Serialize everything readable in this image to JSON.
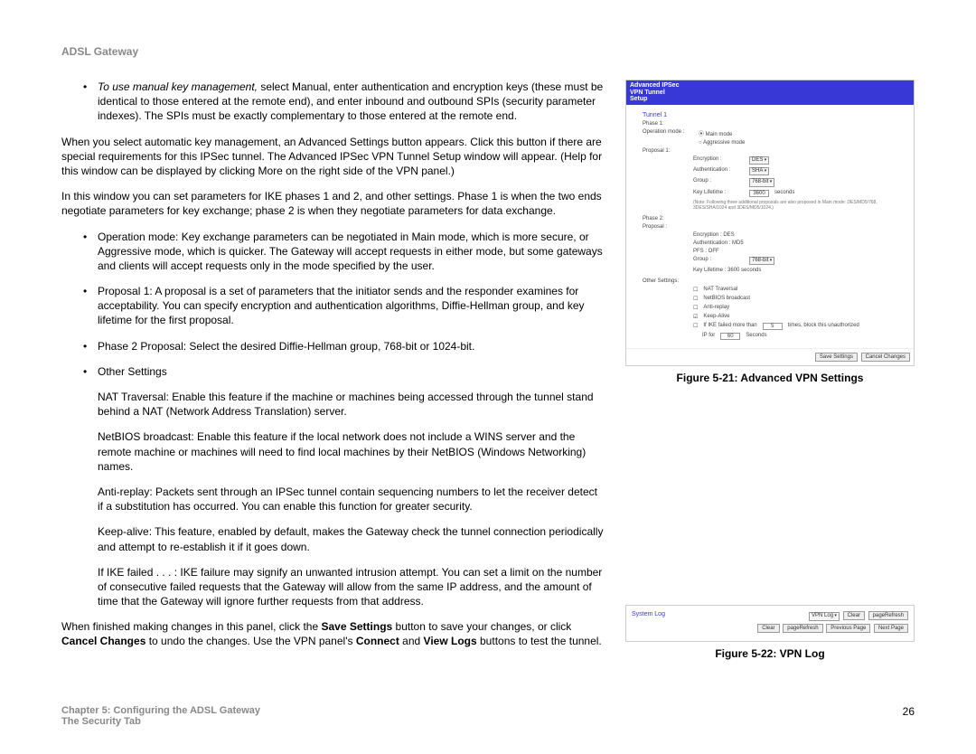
{
  "header": {
    "title": "ADSL Gateway"
  },
  "text": {
    "bullet_manual_pre": "To use manual key management,",
    "bullet_manual_post": " select Manual, enter authentication and encryption keys (these must be identical to those entered at the remote end), and enter inbound and outbound SPIs (security parameter indexes). The SPIs must be exactly complementary to those entered at the remote end.",
    "para_auto": "When you select automatic key management, an Advanced Settings button appears. Click this button if there are special requirements for this IPSec tunnel. The Advanced IPSec VPN Tunnel Setup window will appear. (Help for this window can be displayed by clicking More on the right side of the VPN panel.)",
    "para_phases": "In this window you can set parameters for IKE phases 1 and 2, and other settings. Phase 1 is when the two ends negotiate parameters for key exchange; phase 2 is when they negotiate parameters for data exchange.",
    "b_op": "Operation mode: Key exchange parameters can be negotiated in Main mode, which is more secure, or Aggressive mode, which is quicker. The Gateway will accept requests in either mode, but some gateways and clients will accept requests only in the mode specified by the user.",
    "b_prop1": "Proposal 1: A proposal is a set of parameters that the initiator sends and the responder examines for acceptability. You can specify encryption and authentication algorithms, Diffie-Hellman group, and key lifetime for the first proposal.",
    "b_phase2": "Phase 2 Proposal: Select the desired Diffie-Hellman group, 768-bit or 1024-bit.",
    "b_other": "Other Settings",
    "sub_nat": "NAT Traversal: Enable this feature if the machine or machines being accessed through the tunnel stand behind a NAT (Network Address Translation) server.",
    "sub_netbios": "NetBIOS broadcast: Enable this feature if the local network does not include a WINS server and the remote machine or machines will need to find local machines by their NetBIOS (Windows Networking) names.",
    "sub_anti": "Anti-replay: Packets sent through an IPSec tunnel contain sequencing numbers to let the receiver detect if a substitution has occurred. You can enable this function for greater security.",
    "sub_keep": "Keep-alive: This feature, enabled by default, makes the Gateway check the tunnel connection periodically and attempt to re-establish it if it goes down.",
    "sub_ike": "If IKE failed . . . : IKE failure may signify an unwanted intrusion attempt. You can set a limit on the number of consecutive failed requests that the Gateway will allow from the same IP address, and the amount of time that the Gateway will ignore further requests from that address.",
    "final_pre": "When finished making changes in this panel, click the ",
    "final_save": "Save Settings",
    "final_mid1": " button to save your changes, or click ",
    "final_cancel": "Cancel Changes",
    "final_mid2": " to undo the changes. Use the VPN panel's ",
    "final_connect": "Connect",
    "final_and": " and ",
    "final_view": "View Logs",
    "final_end": " buttons to test the tunnel."
  },
  "fig1": {
    "caption": "Figure 5-21: Advanced VPN Settings",
    "header": "Advanced IPSec\nVPN Tunnel\nSetup",
    "tunnel": "Tunnel 1",
    "phase1": "Phase 1:",
    "opmode": "Operation mode :",
    "main": "Main mode",
    "aggr": "Aggressive mode",
    "prop1": "Proposal 1:",
    "enc": "Encryption :",
    "enc_v": "DES",
    "auth": "Authentication :",
    "auth_v": "SHA",
    "group": "Group :",
    "group_v": "768-bit",
    "keylife": "Key Lifetime :",
    "keylife_v": "3600",
    "seconds": "seconds",
    "note": "(Note: Following three additional proposals are also proposed in Main mode: DES/MD5/768, 3DES/SHA/1024 and 3DES/MD5/1024.)",
    "phase2": "Phase 2:",
    "proposal": "Proposal :",
    "p2_enc": "Encryption :     DES",
    "p2_auth": "Authentication :  MD5",
    "p2_pfs": "PFS :               OFF",
    "p2_group": "Group :",
    "p2_group_v": "768-bit",
    "p2_keylife": "Key Lifetime :   3600  seconds",
    "other": "Other Settings:",
    "c_nat": "NAT Traversal",
    "c_netbios": "NetBIOS broadcast",
    "c_anti": "Anti-replay",
    "c_keep": "Keep-Alive",
    "c_ike_pre": "If IKE failed more than",
    "c_ike_n": "5",
    "c_ike_post": "times, block this unauthorized",
    "c_ip": "IP for",
    "c_ip_n": "60",
    "c_ip_sec": "Seconds",
    "save": "Save Settings",
    "cancel": "Cancel Changes"
  },
  "fig2": {
    "caption": "Figure 5-22: VPN Log",
    "syslog": "System Log",
    "sel": "VPN Log",
    "clear": "Clear",
    "refresh": "pageRefresh",
    "prev": "Previous Page",
    "next": "Next Page"
  },
  "footer": {
    "chap": "Chapter 5: Configuring the ADSL Gateway",
    "sec": "The Security Tab",
    "page": "26"
  }
}
